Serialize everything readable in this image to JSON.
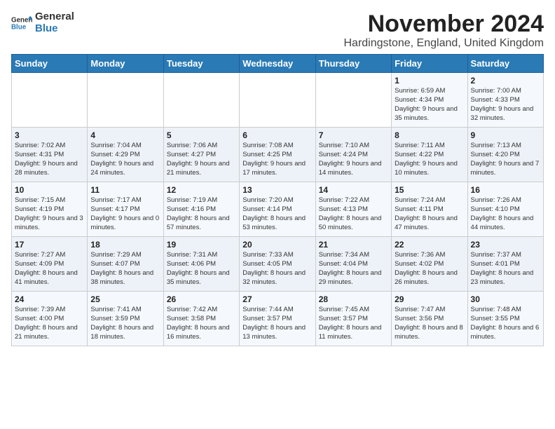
{
  "logo": {
    "line1": "General",
    "line2": "Blue"
  },
  "title": "November 2024",
  "location": "Hardingstone, England, United Kingdom",
  "weekdays": [
    "Sunday",
    "Monday",
    "Tuesday",
    "Wednesday",
    "Thursday",
    "Friday",
    "Saturday"
  ],
  "weeks": [
    [
      {
        "day": "",
        "info": ""
      },
      {
        "day": "",
        "info": ""
      },
      {
        "day": "",
        "info": ""
      },
      {
        "day": "",
        "info": ""
      },
      {
        "day": "",
        "info": ""
      },
      {
        "day": "1",
        "info": "Sunrise: 6:59 AM\nSunset: 4:34 PM\nDaylight: 9 hours\nand 35 minutes."
      },
      {
        "day": "2",
        "info": "Sunrise: 7:00 AM\nSunset: 4:33 PM\nDaylight: 9 hours\nand 32 minutes."
      }
    ],
    [
      {
        "day": "3",
        "info": "Sunrise: 7:02 AM\nSunset: 4:31 PM\nDaylight: 9 hours\nand 28 minutes."
      },
      {
        "day": "4",
        "info": "Sunrise: 7:04 AM\nSunset: 4:29 PM\nDaylight: 9 hours\nand 24 minutes."
      },
      {
        "day": "5",
        "info": "Sunrise: 7:06 AM\nSunset: 4:27 PM\nDaylight: 9 hours\nand 21 minutes."
      },
      {
        "day": "6",
        "info": "Sunrise: 7:08 AM\nSunset: 4:25 PM\nDaylight: 9 hours\nand 17 minutes."
      },
      {
        "day": "7",
        "info": "Sunrise: 7:10 AM\nSunset: 4:24 PM\nDaylight: 9 hours\nand 14 minutes."
      },
      {
        "day": "8",
        "info": "Sunrise: 7:11 AM\nSunset: 4:22 PM\nDaylight: 9 hours\nand 10 minutes."
      },
      {
        "day": "9",
        "info": "Sunrise: 7:13 AM\nSunset: 4:20 PM\nDaylight: 9 hours\nand 7 minutes."
      }
    ],
    [
      {
        "day": "10",
        "info": "Sunrise: 7:15 AM\nSunset: 4:19 PM\nDaylight: 9 hours\nand 3 minutes."
      },
      {
        "day": "11",
        "info": "Sunrise: 7:17 AM\nSunset: 4:17 PM\nDaylight: 9 hours\nand 0 minutes."
      },
      {
        "day": "12",
        "info": "Sunrise: 7:19 AM\nSunset: 4:16 PM\nDaylight: 8 hours\nand 57 minutes."
      },
      {
        "day": "13",
        "info": "Sunrise: 7:20 AM\nSunset: 4:14 PM\nDaylight: 8 hours\nand 53 minutes."
      },
      {
        "day": "14",
        "info": "Sunrise: 7:22 AM\nSunset: 4:13 PM\nDaylight: 8 hours\nand 50 minutes."
      },
      {
        "day": "15",
        "info": "Sunrise: 7:24 AM\nSunset: 4:11 PM\nDaylight: 8 hours\nand 47 minutes."
      },
      {
        "day": "16",
        "info": "Sunrise: 7:26 AM\nSunset: 4:10 PM\nDaylight: 8 hours\nand 44 minutes."
      }
    ],
    [
      {
        "day": "17",
        "info": "Sunrise: 7:27 AM\nSunset: 4:09 PM\nDaylight: 8 hours\nand 41 minutes."
      },
      {
        "day": "18",
        "info": "Sunrise: 7:29 AM\nSunset: 4:07 PM\nDaylight: 8 hours\nand 38 minutes."
      },
      {
        "day": "19",
        "info": "Sunrise: 7:31 AM\nSunset: 4:06 PM\nDaylight: 8 hours\nand 35 minutes."
      },
      {
        "day": "20",
        "info": "Sunrise: 7:33 AM\nSunset: 4:05 PM\nDaylight: 8 hours\nand 32 minutes."
      },
      {
        "day": "21",
        "info": "Sunrise: 7:34 AM\nSunset: 4:04 PM\nDaylight: 8 hours\nand 29 minutes."
      },
      {
        "day": "22",
        "info": "Sunrise: 7:36 AM\nSunset: 4:02 PM\nDaylight: 8 hours\nand 26 minutes."
      },
      {
        "day": "23",
        "info": "Sunrise: 7:37 AM\nSunset: 4:01 PM\nDaylight: 8 hours\nand 23 minutes."
      }
    ],
    [
      {
        "day": "24",
        "info": "Sunrise: 7:39 AM\nSunset: 4:00 PM\nDaylight: 8 hours\nand 21 minutes."
      },
      {
        "day": "25",
        "info": "Sunrise: 7:41 AM\nSunset: 3:59 PM\nDaylight: 8 hours\nand 18 minutes."
      },
      {
        "day": "26",
        "info": "Sunrise: 7:42 AM\nSunset: 3:58 PM\nDaylight: 8 hours\nand 16 minutes."
      },
      {
        "day": "27",
        "info": "Sunrise: 7:44 AM\nSunset: 3:57 PM\nDaylight: 8 hours\nand 13 minutes."
      },
      {
        "day": "28",
        "info": "Sunrise: 7:45 AM\nSunset: 3:57 PM\nDaylight: 8 hours\nand 11 minutes."
      },
      {
        "day": "29",
        "info": "Sunrise: 7:47 AM\nSunset: 3:56 PM\nDaylight: 8 hours\nand 8 minutes."
      },
      {
        "day": "30",
        "info": "Sunrise: 7:48 AM\nSunset: 3:55 PM\nDaylight: 8 hours\nand 6 minutes."
      }
    ]
  ]
}
